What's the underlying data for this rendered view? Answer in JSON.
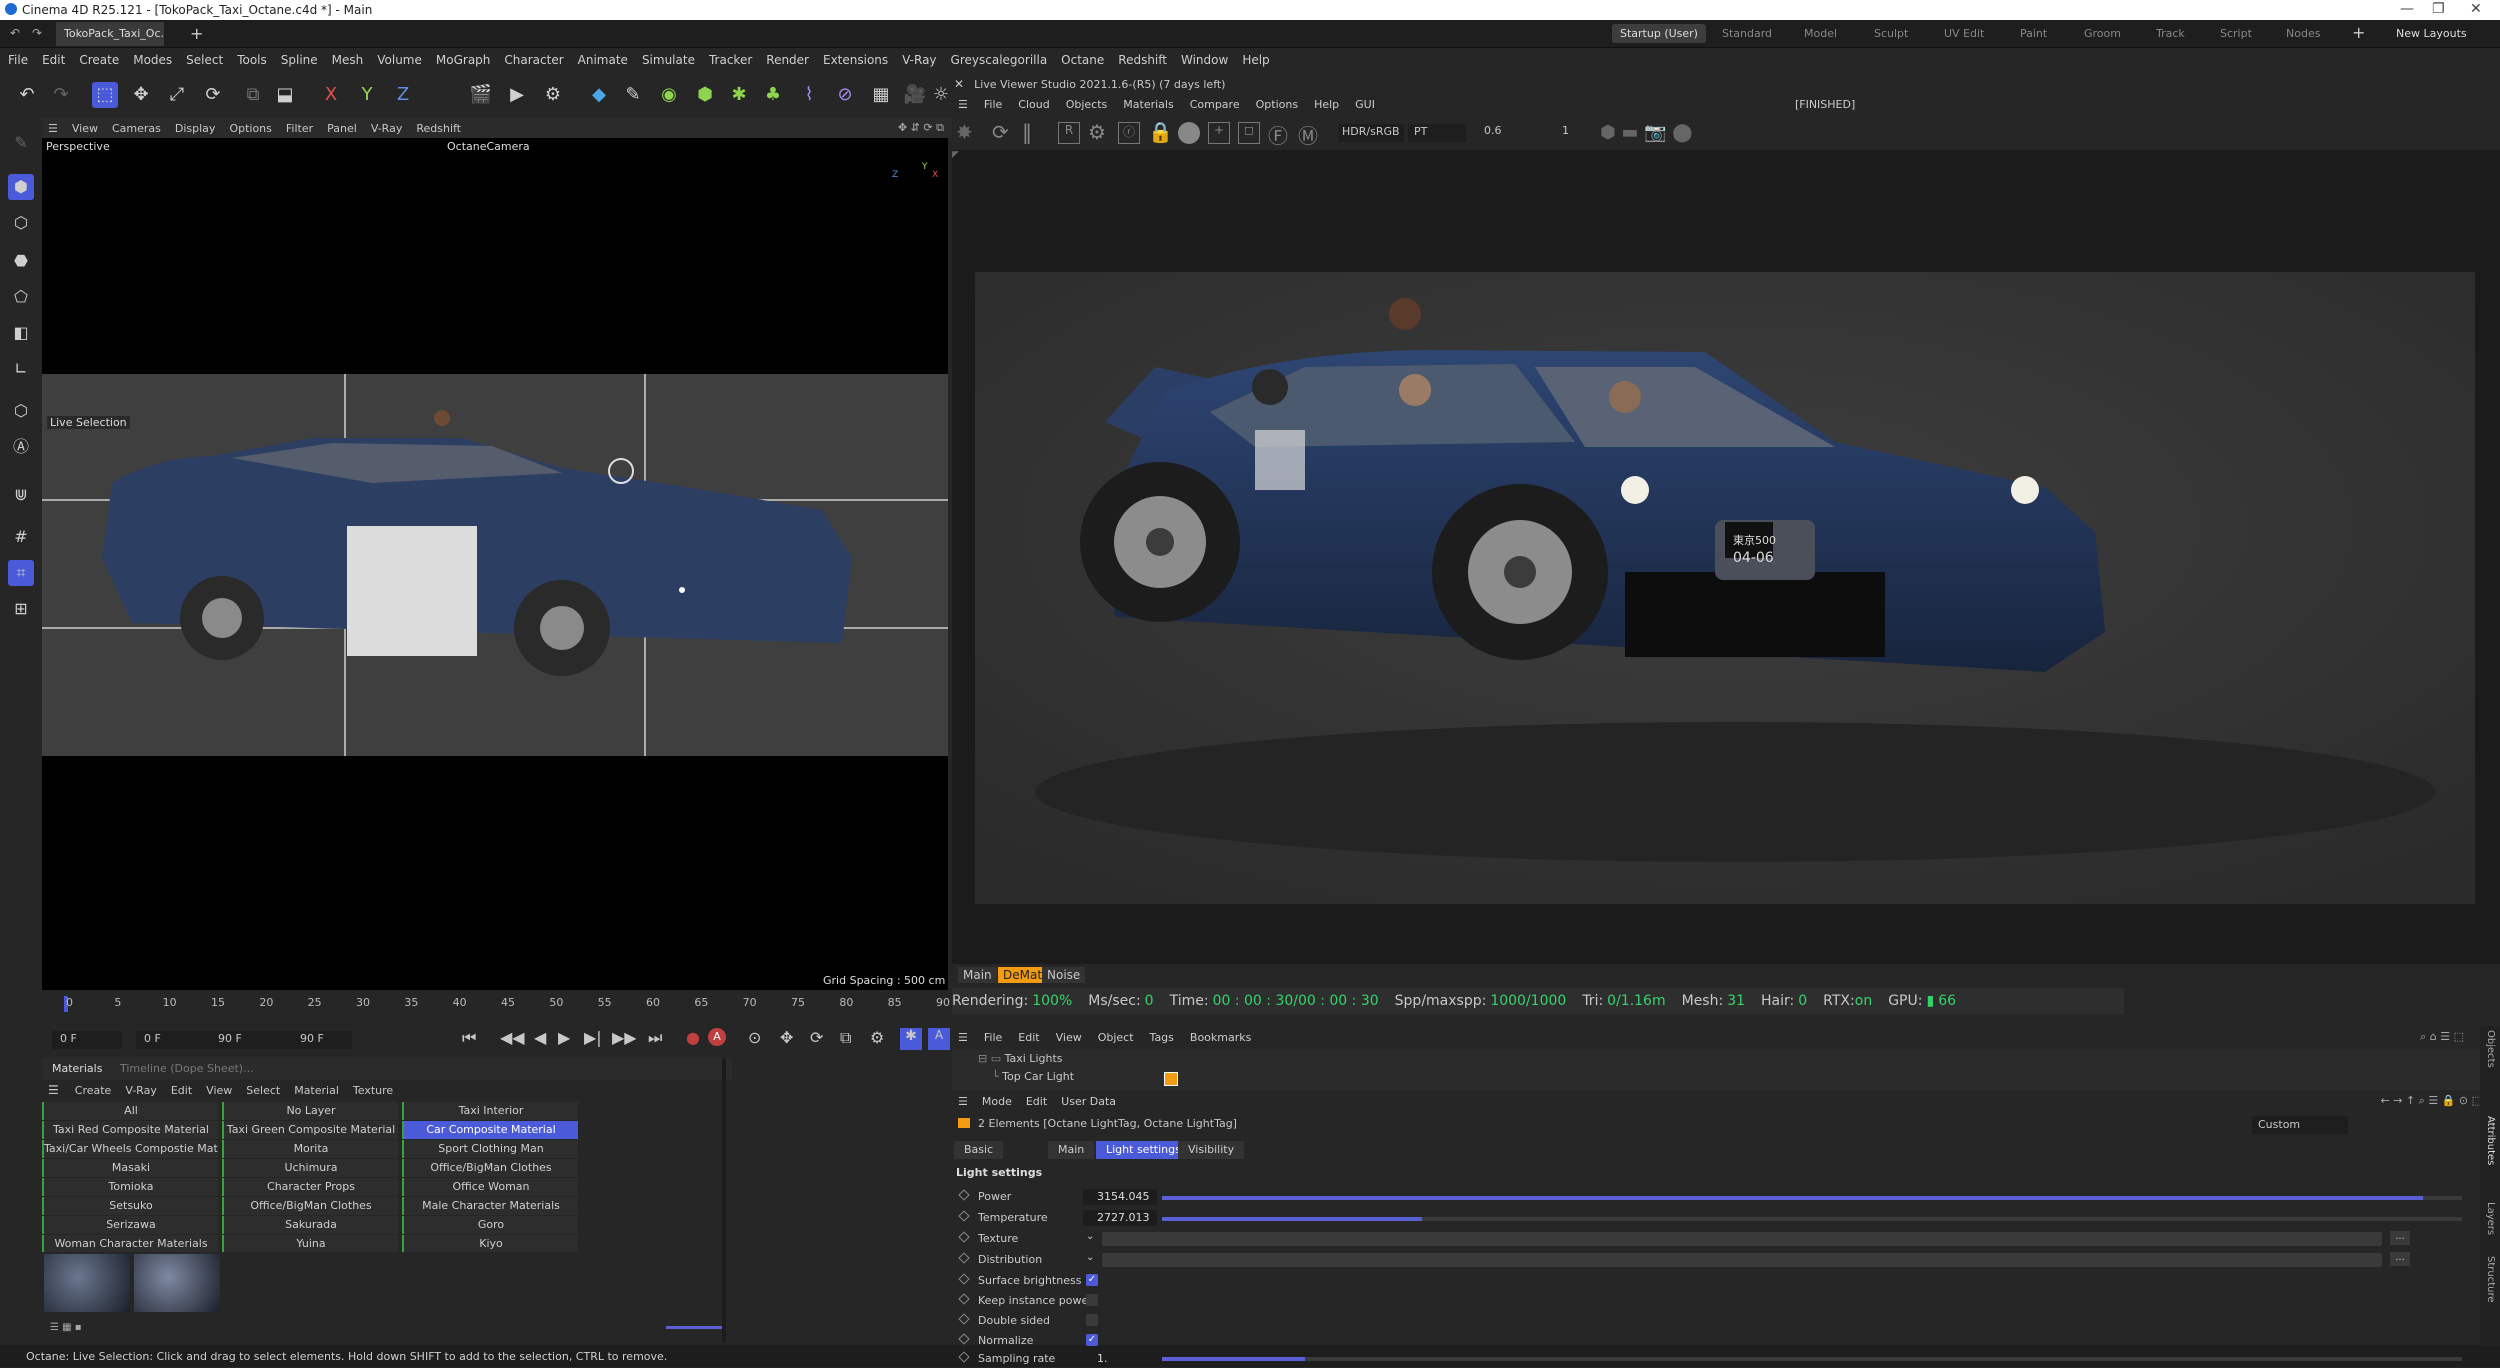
{
  "window": {
    "title": "Cinema 4D R25.121 - [TokoPack_Taxi_Octane.c4d *] - Main",
    "controls": [
      "—",
      "❐",
      "✕"
    ]
  },
  "doc_tab": "TokoPack_Taxi_Oc...",
  "layout_tabs": [
    "Startup (User)",
    "Standard",
    "Model",
    "Sculpt",
    "UV Edit",
    "Paint",
    "Groom",
    "Track",
    "Script",
    "Nodes"
  ],
  "new_layouts": "New Layouts",
  "menu": [
    "File",
    "Edit",
    "Create",
    "Modes",
    "Select",
    "Tools",
    "Spline",
    "Mesh",
    "Volume",
    "MoGraph",
    "Character",
    "Animate",
    "Simulate",
    "Tracker",
    "Render",
    "Extensions",
    "V-Ray",
    "Greyscalegorilla",
    "Octane",
    "Redshift",
    "Window",
    "Help"
  ],
  "toolbar_axes": {
    "x": "X",
    "y": "Y",
    "z": "Z"
  },
  "viewport": {
    "menu": [
      "View",
      "Cameras",
      "Display",
      "Options",
      "Filter",
      "Panel",
      "V-Ray",
      "Redshift"
    ],
    "label": "Perspective",
    "camera": "OctaneCamera",
    "live_selection": "Live Selection",
    "grid_spacing": "Grid Spacing : 500 cm",
    "axis_x": "X",
    "axis_y": "Y",
    "axis_z": "Z"
  },
  "timeline": {
    "ticks": [
      "0",
      "5",
      "10",
      "15",
      "20",
      "25",
      "30",
      "35",
      "40",
      "45",
      "50",
      "55",
      "60",
      "65",
      "70",
      "75",
      "80",
      "85",
      "90"
    ],
    "start_field": "0 F",
    "current_field": "0 F",
    "end_field": "90 F",
    "end_field2": "90 F"
  },
  "materials": {
    "tabs": [
      "Materials",
      "Timeline (Dope Sheet)..."
    ],
    "menu": [
      "Create",
      "V-Ray",
      "Edit",
      "View",
      "Select",
      "Material",
      "Texture"
    ],
    "cells": [
      [
        "All",
        "No Layer",
        "Taxi Interior"
      ],
      [
        "Taxi Red Composite Material",
        "Taxi Green Composite Material",
        "Car Composite Material"
      ],
      [
        "Taxi/Car Wheels Compostie Material",
        "Morita",
        "Sport Clothing Man"
      ],
      [
        "Masaki",
        "Uchimura",
        "Office/BigMan Clothes"
      ],
      [
        "Tomioka",
        "Character Props",
        "Office Woman"
      ],
      [
        "Setsuko",
        "Office/BigMan Clothes",
        "Male Character Materials"
      ],
      [
        "Serizawa",
        "Sakurada",
        "Goro"
      ],
      [
        "Woman Character Materials",
        "Yuina",
        "Kiyo"
      ]
    ],
    "selected": "Car Composite Material"
  },
  "status_bar": "Octane:      Live Selection: Click and drag to select elements. Hold down SHIFT to add to the selection, CTRL to remove.",
  "live_viewer": {
    "title": "Live Viewer Studio 2021.1.6-(R5) (7 days left)",
    "menu": [
      "File",
      "Cloud",
      "Objects",
      "Materials",
      "Compare",
      "Options",
      "Help",
      "GUI"
    ],
    "finished": "[FINISHED]",
    "colorspace": "HDR/sRGB",
    "kernel": "PT",
    "value1": "0.6",
    "value2": "1",
    "tabs": [
      "Main",
      "DeMat",
      "Noise"
    ],
    "stats": {
      "rendering_label": "Rendering:",
      "rendering": "100%",
      "ms_label": "Ms/sec:",
      "ms": "0",
      "time_label": "Time:",
      "time": "00 : 00 : 30/00 : 00 : 30",
      "spp_label": "Spp/maxspp:",
      "spp": "1000/1000",
      "tri_label": "Tri:",
      "tri": "0/1.16m",
      "mesh_label": "Mesh:",
      "mesh": "31",
      "hair_label": "Hair:",
      "hair": "0",
      "rtx_label": "RTX:",
      "rtx": "on",
      "gpu_label": "GPU:",
      "gpu": "66"
    },
    "plate": {
      "top": "東京500",
      "bottom": "04-06"
    }
  },
  "objects": {
    "menu": [
      "File",
      "Edit",
      "View",
      "Object",
      "Tags",
      "Bookmarks"
    ],
    "items": [
      "Taxi Lights",
      "Top Car Light"
    ]
  },
  "attributes": {
    "menu": [
      "Mode",
      "Edit",
      "User Data"
    ],
    "header": "2 Elements [Octane LightTag, Octane LightTag]",
    "preset": "Custom",
    "tabs": [
      "Basic",
      "Main",
      "Light settings",
      "Visibility"
    ],
    "active_tab": "Light settings",
    "section": "Light settings",
    "props": {
      "power": {
        "label": "Power",
        "value": "3154.045",
        "fraction": 0.97
      },
      "temperature": {
        "label": "Temperature",
        "value": "2727.013",
        "fraction": 0.2
      },
      "texture": {
        "label": "Texture"
      },
      "distribution": {
        "label": "Distribution"
      },
      "surface_brightness": {
        "label": "Surface brightness",
        "checked": true
      },
      "keep_instance_power": {
        "label": "Keep instance power",
        "checked": false
      },
      "double_sided": {
        "label": "Double sided",
        "checked": false
      },
      "normalize": {
        "label": "Normalize",
        "checked": true
      },
      "sampling_rate": {
        "label": "Sampling rate",
        "value": "1.",
        "fraction": 0.11
      }
    },
    "side_tabs": [
      "Objects",
      "Attributes",
      "Layers",
      "Structure"
    ]
  },
  "colors": {
    "accent": "#4a5ad8",
    "orange": "#f39c12",
    "green": "#35d46b"
  }
}
